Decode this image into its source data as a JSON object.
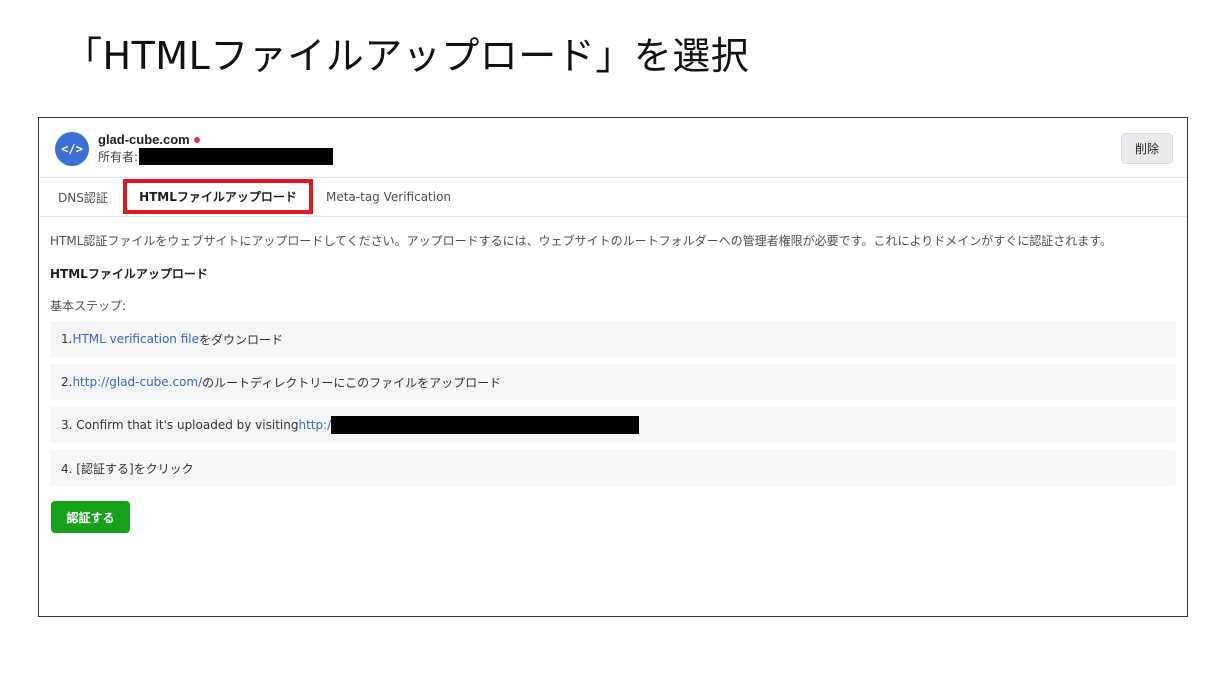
{
  "slide": {
    "title": "「HTMLファイルアップロード」を選択"
  },
  "header": {
    "avatar_icon": "code-icon",
    "avatar_glyph": "</>",
    "domain": "glad-cube.com",
    "status_color": "#e03a3a",
    "owner_label": "所有者:",
    "delete_label": "削除"
  },
  "tabs": [
    {
      "label": "DNS認証",
      "active": false
    },
    {
      "label": "HTMLファイルアップロード",
      "active": true
    },
    {
      "label": "Meta-tag Verification",
      "active": false
    }
  ],
  "content": {
    "description": "HTML認証ファイルをウェブサイトにアップロードしてください。アップロードするには、ウェブサイトのルートフォルダーへの管理者権限が必要です。これによりドメインがすぐに認証されます。",
    "section_heading": "HTMLファイルアップロード",
    "steps_label": "基本ステップ:",
    "steps": [
      {
        "prefix": "1. ",
        "link": "HTML verification file",
        "suffix": "をダウンロード"
      },
      {
        "prefix": "2. ",
        "link": "http://glad-cube.com/",
        "suffix": "のルートディレクトリーにこのファイルをアップロード"
      },
      {
        "prefix": "3. Confirm that it's uploaded by visiting ",
        "link": "http:/",
        "suffix": ""
      },
      {
        "text": "4. [認証する]をクリック"
      }
    ],
    "verify_label": "認証する"
  },
  "colors": {
    "accent_blue": "#3b6fd8",
    "link_blue": "#3b66c4",
    "verify_green": "#16a11a",
    "highlight_red": "#e4161b"
  }
}
